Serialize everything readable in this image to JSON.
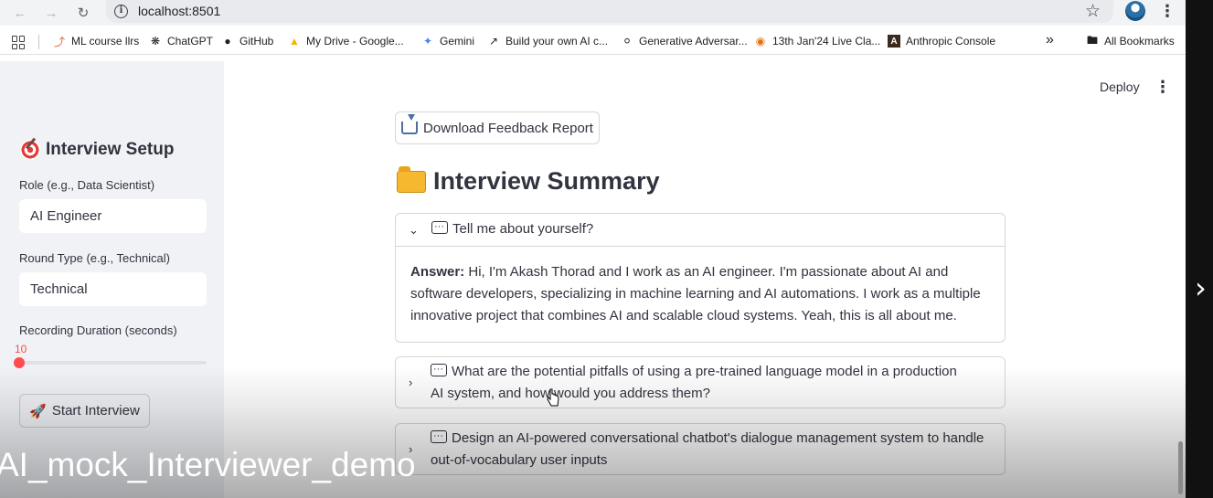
{
  "browser": {
    "url": "localhost:8501",
    "bookmarks": [
      {
        "label": "ML course llrs",
        "icon": "ml-icon"
      },
      {
        "label": "ChatGPT",
        "icon": "chatgpt-icon"
      },
      {
        "label": "GitHub",
        "icon": "github-icon"
      },
      {
        "label": "My Drive - Google...",
        "icon": "drive-icon"
      },
      {
        "label": "Gemini",
        "icon": "gemini-icon"
      },
      {
        "label": "Build your own AI c...",
        "icon": "chart-icon"
      },
      {
        "label": "Generative Adversar...",
        "icon": "globe-icon"
      },
      {
        "label": "13th Jan'24 Live Cla...",
        "icon": "live-icon"
      },
      {
        "label": "Anthropic Console",
        "icon": "anthropic-icon"
      }
    ],
    "all_bookmarks": "All Bookmarks"
  },
  "sidebar": {
    "title": "Interview Setup",
    "role_label": "Role (e.g., Data Scientist)",
    "role_value": "AI Engineer",
    "round_label": "Round Type (e.g., Technical)",
    "round_value": "Technical",
    "duration_label": "Recording Duration (seconds)",
    "duration_value": "10",
    "start_button": "Start Interview"
  },
  "header": {
    "deploy": "Deploy"
  },
  "main": {
    "download_button": "Download Feedback Report",
    "summary_title": "Interview Summary",
    "questions": [
      {
        "question": "Tell me about yourself?",
        "expanded": true,
        "answer_label": "Answer:",
        "answer": "Hi, I'm Akash Thorad and I work as an AI engineer. I'm passionate about AI and software developers, specializing in machine learning and AI automations. I work as a multiple innovative project that combines AI and scalable cloud systems. Yeah, this is all about me."
      },
      {
        "question": "What are the potential pitfalls of using a pre-trained language model in a production AI system, and how would you address them?",
        "expanded": false
      },
      {
        "question": "Design an AI-powered conversational chatbot's dialogue management system to handle out-of-vocabulary user inputs",
        "expanded": false
      }
    ]
  },
  "overlay": {
    "watermark": "AI_mock_Interviewer_demo"
  },
  "colors": {
    "accent": "#ff4b4b",
    "sidebar_bg": "#f0f2f6"
  }
}
